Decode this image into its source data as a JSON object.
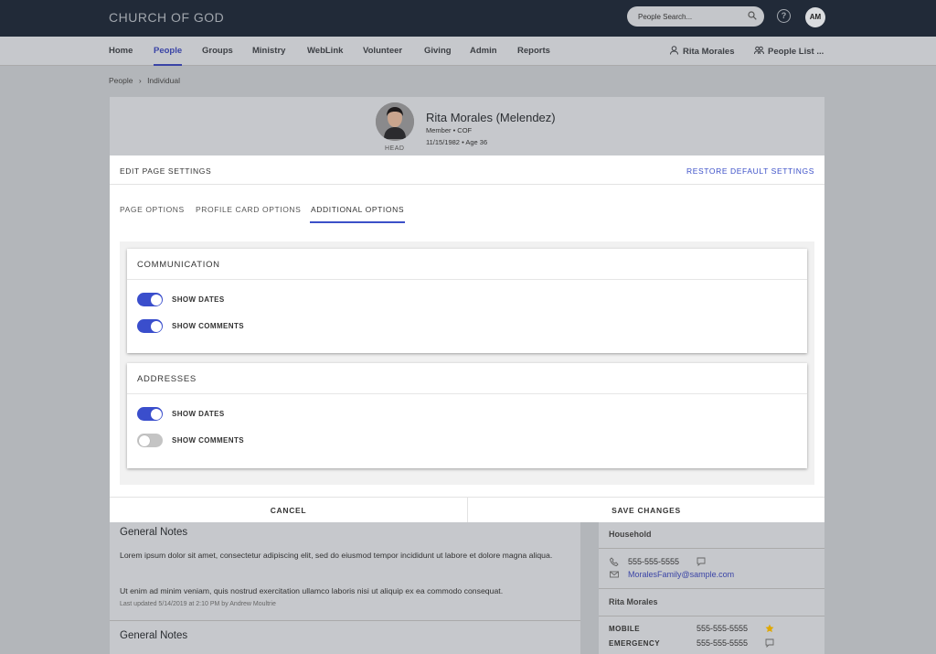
{
  "app": {
    "brand": "CHURCH OF GOD",
    "search_placeholder": "People Search...",
    "user_initials": "AM",
    "help": "?"
  },
  "nav": {
    "items": [
      "Home",
      "People",
      "Groups",
      "Ministry",
      "WebLink",
      "Volunteer",
      "Giving",
      "Admin",
      "Reports"
    ],
    "active": "People",
    "right_user": "Rita Morales",
    "right_list": "People List ..."
  },
  "breadcrumb": {
    "root": "People",
    "separator": "›",
    "current": "Individual"
  },
  "profile": {
    "name": "Rita Morales (Melendez)",
    "role_line": "Member • COF",
    "dob_line": "11/15/1982 • Age 36",
    "photo_label": "HEAD"
  },
  "modal": {
    "title": "EDIT PAGE SETTINGS",
    "restore": "RESTORE DEFAULT SETTINGS",
    "tabs": [
      "PAGE OPTIONS",
      "PROFILE CARD OPTIONS",
      "ADDITIONAL OPTIONS"
    ],
    "active_tab": "ADDITIONAL OPTIONS",
    "sections": [
      {
        "title": "COMMUNICATION",
        "toggles": [
          {
            "label": "SHOW DATES",
            "on": true
          },
          {
            "label": "SHOW COMMENTS",
            "on": true
          }
        ]
      },
      {
        "title": "ADDRESSES",
        "toggles": [
          {
            "label": "SHOW DATES",
            "on": true
          },
          {
            "label": "SHOW COMMENTS",
            "on": false
          }
        ]
      }
    ],
    "cancel": "CANCEL",
    "save": "SAVE CHANGES"
  },
  "notes": {
    "title1": "General Notes",
    "para1": "Lorem ipsum dolor sit amet, consectetur adipiscing elit, sed do eiusmod tempor incididunt ut labore et dolore magna aliqua.",
    "para2": "Ut enim ad minim veniam, quis nostrud exercitation ullamco laboris nisi ut aliquip ex ea commodo consequat.",
    "updated": "Last updated 5/14/2019 at 2:10 PM by Andrew Moultrie",
    "title2": "General Notes"
  },
  "household": {
    "title": "Household",
    "phone": "555-555-5555",
    "email": "MoralesFamily@sample.com",
    "member": "Rita Morales",
    "mobile_label": "MOBILE",
    "mobile": "555-555-5555",
    "emergency_label": "EMERGENCY",
    "emergency": "555-555-5555"
  },
  "colors": {
    "accent": "#3c50c8",
    "topbar": "#212a38",
    "star": "#e0a800"
  }
}
